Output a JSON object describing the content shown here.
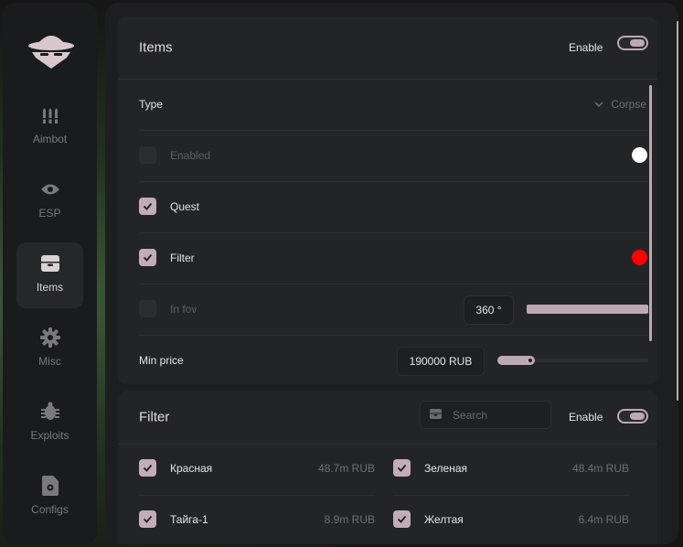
{
  "sidebar": {
    "items": [
      {
        "label": "Aimbot",
        "icon": "bullets-icon"
      },
      {
        "label": "ESP",
        "icon": "eye-icon"
      },
      {
        "label": "Items",
        "icon": "box-icon",
        "active": true
      },
      {
        "label": "Misc",
        "icon": "gear-icon"
      },
      {
        "label": "Exploits",
        "icon": "bug-icon"
      },
      {
        "label": "Configs",
        "icon": "file-gear-icon"
      }
    ]
  },
  "items_panel": {
    "title": "Items",
    "enable_label": "Enable",
    "enabled": true,
    "type_label": "Type",
    "type_value": "Corpse",
    "rows": [
      {
        "label": "Enabled",
        "checked": false,
        "dim": true,
        "color": "#ffffff"
      },
      {
        "label": "Quest",
        "checked": true,
        "dim": false
      },
      {
        "label": "Filter",
        "checked": true,
        "dim": false,
        "color": "#ff0000"
      },
      {
        "label": "In fov",
        "checked": false,
        "dim": true,
        "value": "360 °",
        "slider": 1.0
      },
      {
        "label": "Min price",
        "checked": null,
        "dim": false,
        "value": "190000 RUB",
        "slider": 0.25
      }
    ]
  },
  "filter_panel": {
    "title": "Filter",
    "search_placeholder": "Search",
    "enable_label": "Enable",
    "enabled": true,
    "items": [
      {
        "name": "Красная",
        "price": "48.7m RUB",
        "checked": true
      },
      {
        "name": "Зеленая",
        "price": "48.4m RUB",
        "checked": true
      },
      {
        "name": "Тайга-1",
        "price": "8.9m RUB",
        "checked": true
      },
      {
        "name": "Желтая",
        "price": "6.4m RUB",
        "checked": true
      }
    ]
  },
  "colors": {
    "accent": "#bcaab2",
    "checkbox": "#c2adb6",
    "panel": "#232426",
    "background": "#1d1e20"
  }
}
